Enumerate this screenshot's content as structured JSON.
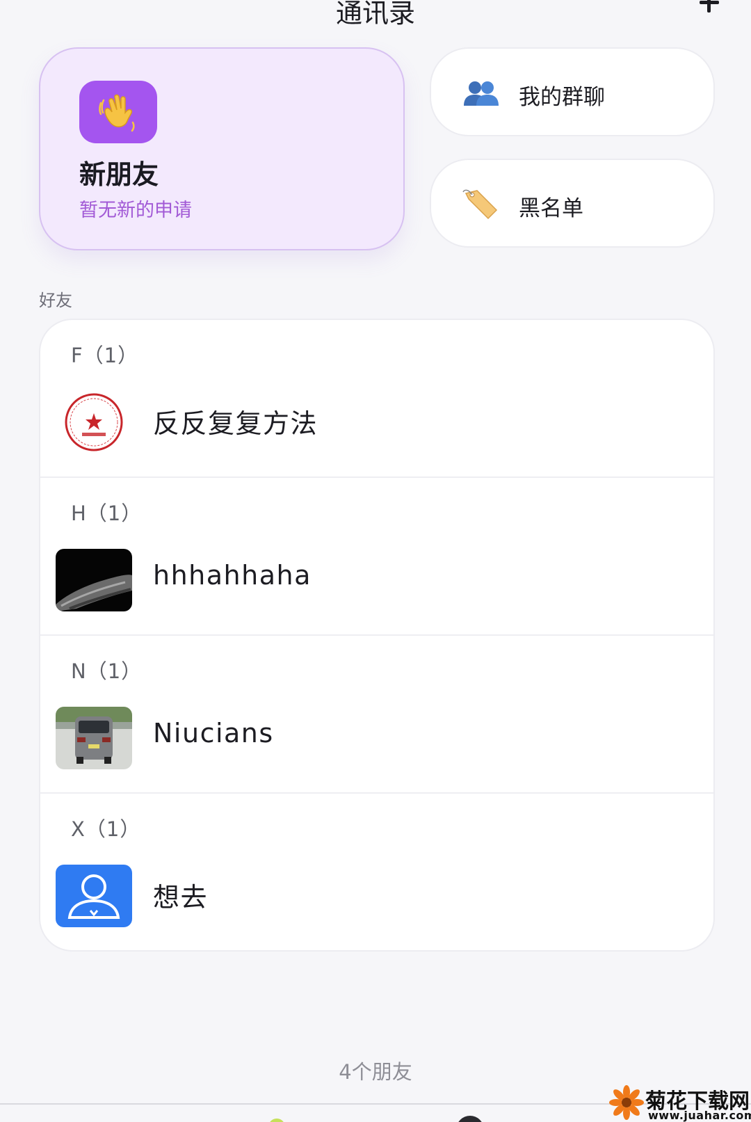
{
  "header": {
    "title": "通讯录",
    "add_icon": "plus-icon"
  },
  "new_friends": {
    "title": "新朋友",
    "subtitle": "暂无新的申请",
    "icon": "waving-hand-icon",
    "accent": "#a455ef"
  },
  "shortcuts": {
    "groups": {
      "label": "我的群聊",
      "icon": "two-people-icon"
    },
    "blacklist": {
      "label": "黑名单",
      "icon": "tag-icon"
    }
  },
  "section_label": "好友",
  "friend_groups": [
    {
      "header": "F（1）",
      "name": "反反复复方法",
      "avatar": "red-seal-avatar"
    },
    {
      "header": "H（1）",
      "name": "hhhahhaha",
      "avatar": "dark-moon-avatar"
    },
    {
      "header": "N（1）",
      "name": "Niucians",
      "avatar": "car-photo-avatar"
    },
    {
      "header": "X（1）",
      "name": "想去",
      "avatar": "default-person-avatar"
    }
  ],
  "friend_count": "4个朋友",
  "watermark": {
    "text": "菊花下载网",
    "url": "www.juahar.com"
  }
}
